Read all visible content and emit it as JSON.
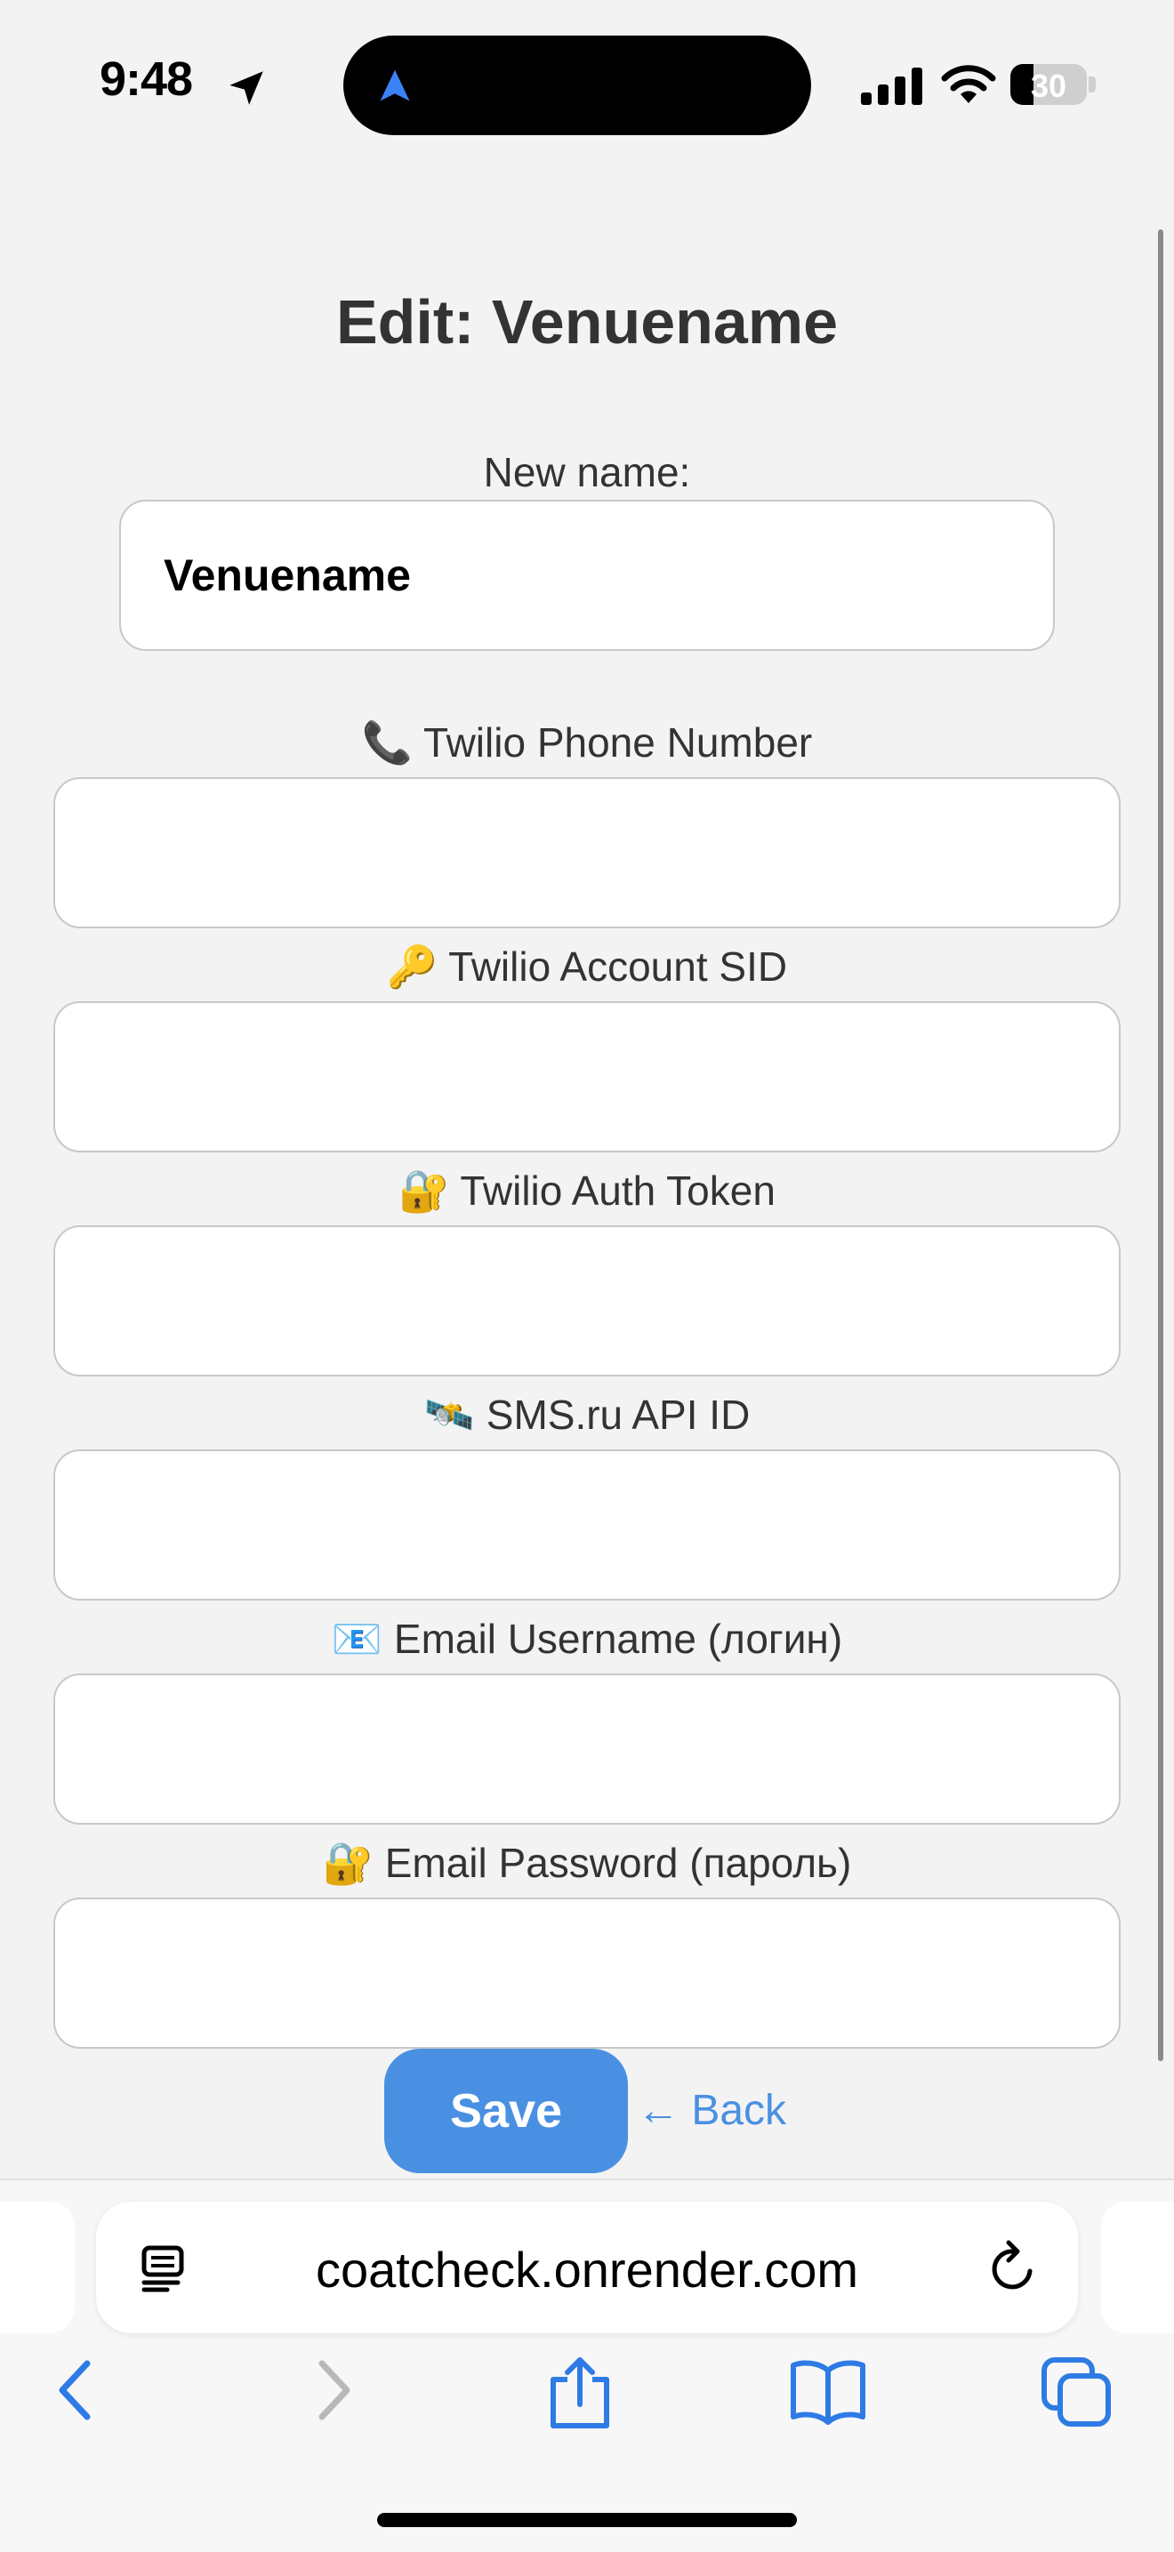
{
  "status_bar": {
    "time": "9:48",
    "battery": "30",
    "battery_level": 0.3
  },
  "form": {
    "title": "Edit: Venuename",
    "name_label": "New name:",
    "name_value": "Venuename",
    "fields": [
      {
        "emoji": "📞",
        "label": "Twilio Phone Number",
        "value": ""
      },
      {
        "emoji": "🔑",
        "label": "Twilio Account SID",
        "value": ""
      },
      {
        "emoji": "🔐",
        "label": "Twilio Auth Token",
        "value": ""
      },
      {
        "emoji": "🛰️",
        "label": "SMS.ru API ID",
        "value": ""
      },
      {
        "emoji": "📧",
        "label": "Email Username (логин)",
        "value": ""
      },
      {
        "emoji": "🔐",
        "label": "Email Password (пароль)",
        "value": ""
      }
    ],
    "save_label": "Save",
    "back_label": "← Back"
  },
  "browser": {
    "url": "coatcheck.onrender.com"
  },
  "colors": {
    "accent": "#4a90e2",
    "toolbar_icon": "#2f7be6",
    "disabled_icon": "#b8b8b8"
  },
  "icons": [
    "location-arrow-icon",
    "navigation-icon",
    "signal-icon",
    "wifi-icon",
    "battery-icon",
    "reader-icon",
    "reload-icon",
    "back-icon",
    "forward-icon",
    "share-icon",
    "bookmarks-icon",
    "tabs-icon"
  ]
}
